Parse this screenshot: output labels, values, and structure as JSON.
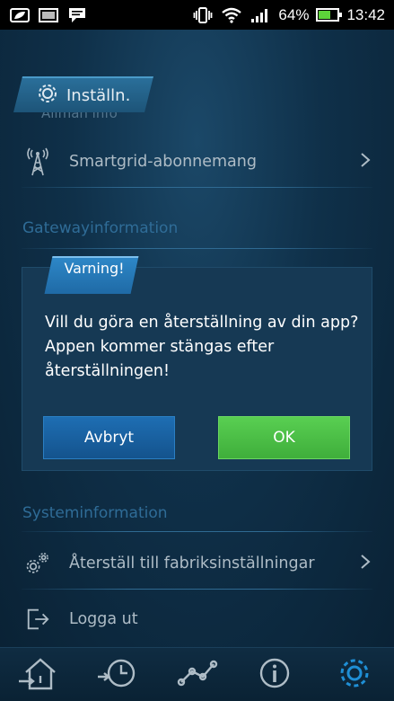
{
  "status_bar": {
    "battery_percent": "64%",
    "battery_level": 0.64,
    "time": "13:42",
    "left_icons": [
      "leaf-notification-icon",
      "image-notification-icon",
      "message-notification-icon"
    ],
    "right_icons": [
      "vibrate-icon",
      "wifi-icon",
      "signal-icon",
      "battery-icon"
    ]
  },
  "header": {
    "title": "Inställn.",
    "partial_subtitle": "Allmän info"
  },
  "rows": {
    "smartgrid_label": "Smartgrid-abonnemang",
    "reset_label": "Återställ till fabriksinställningar",
    "logout_label": "Logga ut"
  },
  "sections": {
    "gateway": "Gatewayinformation",
    "system": "Systeminformation"
  },
  "dialog": {
    "title": "Varning!",
    "message": "Vill du göra en återställning av din app? Appen kommer stängas efter återställningen!",
    "cancel_label": "Avbryt",
    "ok_label": "OK"
  },
  "bottom_nav": {
    "items": [
      "home-heat-icon",
      "history-icon",
      "graph-icon",
      "info-icon",
      "settings-gear-icon"
    ],
    "active": "settings-gear-icon"
  },
  "colors": {
    "accent_blue": "#2d87c7",
    "ok_green": "#4fc247",
    "section_heading": "#2f6c97",
    "active_nav": "#1f8fd6"
  }
}
